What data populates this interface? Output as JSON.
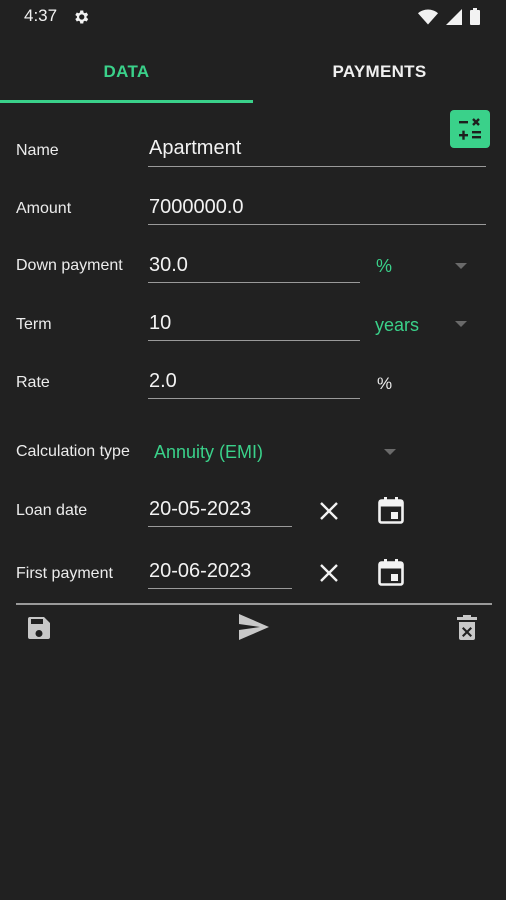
{
  "status": {
    "time": "4:37"
  },
  "tabs": {
    "data": "DATA",
    "payments": "PAYMENTS"
  },
  "form": {
    "name": {
      "label": "Name",
      "value": "Apartment"
    },
    "amount": {
      "label": "Amount",
      "value": "7000000.0"
    },
    "down_payment": {
      "label": "Down payment",
      "value": "30.0",
      "unit": "%"
    },
    "term": {
      "label": "Term",
      "value": "10",
      "unit": "years"
    },
    "rate": {
      "label": "Rate",
      "value": "2.0",
      "unit": "%"
    },
    "calculation_type": {
      "label": "Calculation type",
      "value": "Annuity (EMI)"
    },
    "loan_date": {
      "label": "Loan date",
      "value": "20-05-2023"
    },
    "first_payment": {
      "label": "First payment",
      "value": "20-06-2023"
    }
  },
  "colors": {
    "accent": "#3ad18a",
    "background": "#212121",
    "text": "#ececec"
  },
  "icons": [
    "gear-icon",
    "wifi-icon",
    "signal-icon",
    "battery-icon",
    "calculator-icon",
    "close-icon",
    "calendar-icon",
    "save-icon",
    "send-icon",
    "delete-icon",
    "chevron-down-icon"
  ]
}
